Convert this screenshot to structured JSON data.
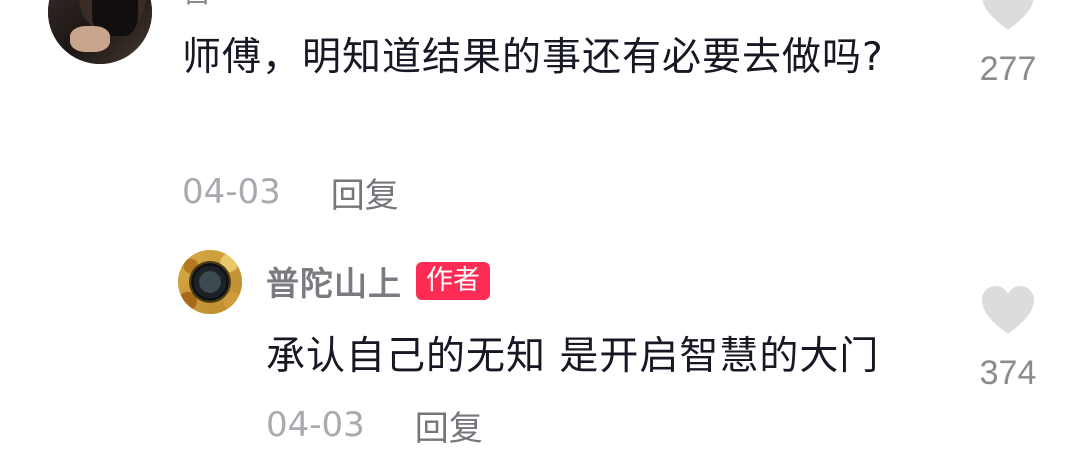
{
  "top_comment": {
    "username_fragment": "吾",
    "text": "师傅，明知道结果的事还有必要去做吗?",
    "date": "04-03",
    "reply_label": "回复",
    "like_count": "277"
  },
  "reply_comment": {
    "author": "普陀山上",
    "author_badge": "作者",
    "text": "承认自己的无知 是开启智慧的大门",
    "date": "04-03",
    "reply_label": "回复",
    "like_count": "374"
  },
  "colors": {
    "badge_bg": "#fe2c55",
    "text_primary": "#161823",
    "text_secondary": "#a9aab0",
    "heart": "#dcdcdf"
  },
  "icons": {
    "like": "heart-icon"
  }
}
